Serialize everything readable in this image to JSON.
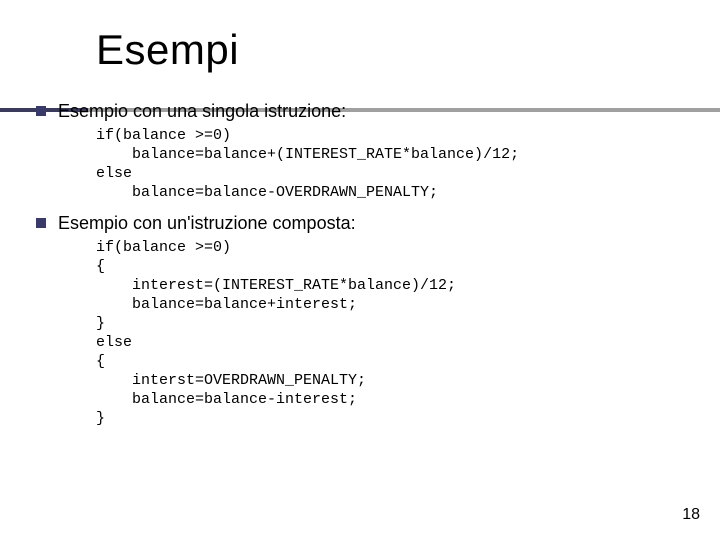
{
  "title": "Esempi",
  "items": [
    {
      "text": "Esempio con una singola istruzione:",
      "code": "if(balance >=0)\n    balance=balance+(INTEREST_RATE*balance)/12;\nelse\n    balance=balance-OVERDRAWN_PENALTY;"
    },
    {
      "text": "Esempio con un'istruzione composta:",
      "code": "if(balance >=0)\n{\n    interest=(INTEREST_RATE*balance)/12;\n    balance=balance+interest;\n}\nelse\n{\n    interst=OVERDRAWN_PENALTY;\n    balance=balance-interest;\n}"
    }
  ],
  "page_number": "18"
}
